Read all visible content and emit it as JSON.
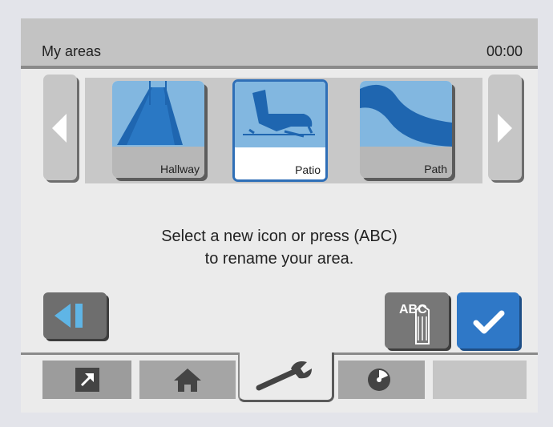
{
  "header": {
    "title": "My areas",
    "time": "00:00"
  },
  "carousel": {
    "items": [
      {
        "label": "Hallway",
        "icon": "hallway-icon",
        "selected": false
      },
      {
        "label": "Patio",
        "icon": "patio-chair-icon",
        "selected": true
      },
      {
        "label": "Path",
        "icon": "path-icon",
        "selected": false
      }
    ]
  },
  "message": {
    "line1": "Select a new icon or press (ABC)",
    "line2": "to rename your area."
  },
  "buttons": {
    "rename_label": "ABC"
  },
  "colors": {
    "accent": "#2f78c7",
    "tile_picture": "#82b7e0",
    "tile_dark": "#1f66b0"
  },
  "tabs": [
    {
      "icon": "shortcut-arrow-icon",
      "active": false
    },
    {
      "icon": "home-icon",
      "active": false
    },
    {
      "icon": "wrench-icon",
      "active": true
    },
    {
      "icon": "disc-icon",
      "active": false
    },
    {
      "icon": "empty-tab",
      "active": false
    }
  ]
}
